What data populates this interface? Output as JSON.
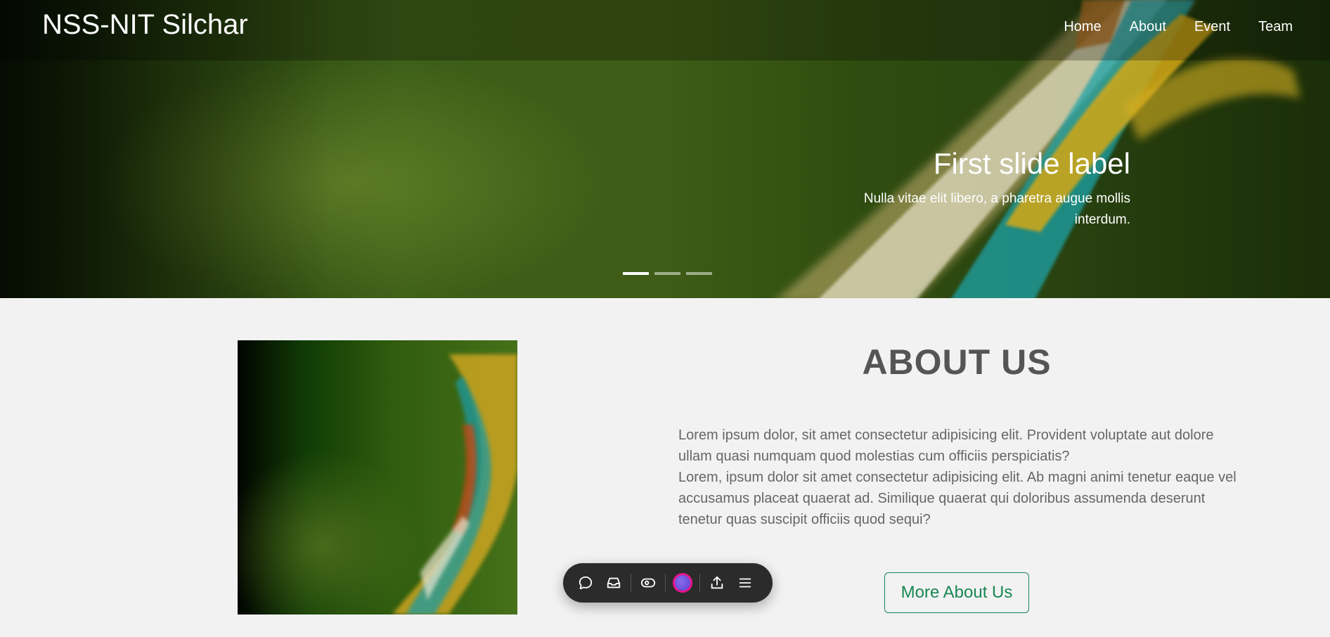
{
  "navbar": {
    "brand": "NSS-NIT Silchar",
    "links": [
      "Home",
      "About",
      "Event",
      "Team"
    ]
  },
  "carousel": {
    "caption_title": "First slide label",
    "caption_text": "Nulla vitae elit libero, a pharetra augue mollis interdum.",
    "slide_count": 3,
    "active_slide": 1
  },
  "about": {
    "title": "ABOUT US",
    "paragraph_1": "Lorem ipsum dolor, sit amet consectetur adipisicing elit. Provident voluptate aut dolore ullam quasi numquam quod molestias cum officiis perspiciatis?",
    "paragraph_2": "Lorem, ipsum dolor sit amet consectetur adipisicing elit. Ab magni animi tenetur eaque vel accusamus placeat quaerat ad. Similique quaerat qui doloribus assumenda deserunt tenetur quas suscipit officiis quod sequi?",
    "button_label": "More About Us"
  },
  "toolbar": {
    "icons": [
      "comment-icon",
      "inbox-icon",
      "eye-icon",
      "avatar",
      "share-icon",
      "menu-icon"
    ]
  },
  "colors": {
    "accent_green": "#198754",
    "heading_gray": "#555555",
    "toolbar_bg": "#2b2b2b",
    "avatar_ring": "#e8158a"
  }
}
